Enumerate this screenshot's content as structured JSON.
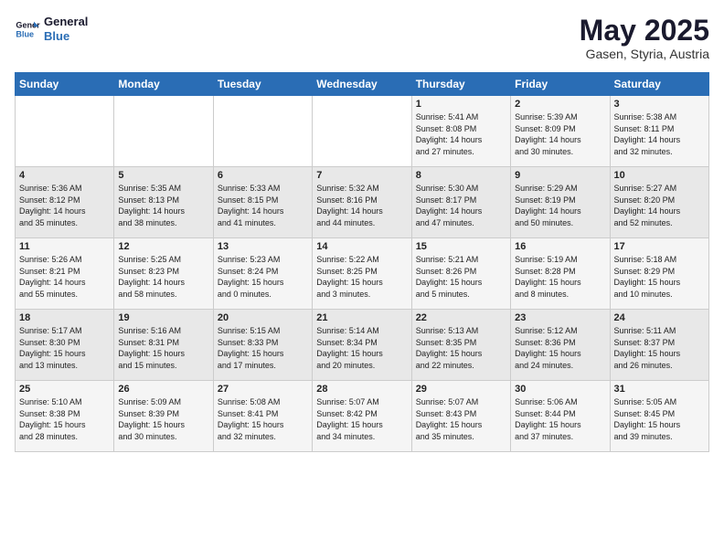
{
  "logo": {
    "line1": "General",
    "line2": "Blue"
  },
  "title": "May 2025",
  "location": "Gasen, Styria, Austria",
  "weekdays": [
    "Sunday",
    "Monday",
    "Tuesday",
    "Wednesday",
    "Thursday",
    "Friday",
    "Saturday"
  ],
  "weeks": [
    [
      {
        "day": "",
        "info": ""
      },
      {
        "day": "",
        "info": ""
      },
      {
        "day": "",
        "info": ""
      },
      {
        "day": "",
        "info": ""
      },
      {
        "day": "1",
        "info": "Sunrise: 5:41 AM\nSunset: 8:08 PM\nDaylight: 14 hours\nand 27 minutes."
      },
      {
        "day": "2",
        "info": "Sunrise: 5:39 AM\nSunset: 8:09 PM\nDaylight: 14 hours\nand 30 minutes."
      },
      {
        "day": "3",
        "info": "Sunrise: 5:38 AM\nSunset: 8:11 PM\nDaylight: 14 hours\nand 32 minutes."
      }
    ],
    [
      {
        "day": "4",
        "info": "Sunrise: 5:36 AM\nSunset: 8:12 PM\nDaylight: 14 hours\nand 35 minutes."
      },
      {
        "day": "5",
        "info": "Sunrise: 5:35 AM\nSunset: 8:13 PM\nDaylight: 14 hours\nand 38 minutes."
      },
      {
        "day": "6",
        "info": "Sunrise: 5:33 AM\nSunset: 8:15 PM\nDaylight: 14 hours\nand 41 minutes."
      },
      {
        "day": "7",
        "info": "Sunrise: 5:32 AM\nSunset: 8:16 PM\nDaylight: 14 hours\nand 44 minutes."
      },
      {
        "day": "8",
        "info": "Sunrise: 5:30 AM\nSunset: 8:17 PM\nDaylight: 14 hours\nand 47 minutes."
      },
      {
        "day": "9",
        "info": "Sunrise: 5:29 AM\nSunset: 8:19 PM\nDaylight: 14 hours\nand 50 minutes."
      },
      {
        "day": "10",
        "info": "Sunrise: 5:27 AM\nSunset: 8:20 PM\nDaylight: 14 hours\nand 52 minutes."
      }
    ],
    [
      {
        "day": "11",
        "info": "Sunrise: 5:26 AM\nSunset: 8:21 PM\nDaylight: 14 hours\nand 55 minutes."
      },
      {
        "day": "12",
        "info": "Sunrise: 5:25 AM\nSunset: 8:23 PM\nDaylight: 14 hours\nand 58 minutes."
      },
      {
        "day": "13",
        "info": "Sunrise: 5:23 AM\nSunset: 8:24 PM\nDaylight: 15 hours\nand 0 minutes."
      },
      {
        "day": "14",
        "info": "Sunrise: 5:22 AM\nSunset: 8:25 PM\nDaylight: 15 hours\nand 3 minutes."
      },
      {
        "day": "15",
        "info": "Sunrise: 5:21 AM\nSunset: 8:26 PM\nDaylight: 15 hours\nand 5 minutes."
      },
      {
        "day": "16",
        "info": "Sunrise: 5:19 AM\nSunset: 8:28 PM\nDaylight: 15 hours\nand 8 minutes."
      },
      {
        "day": "17",
        "info": "Sunrise: 5:18 AM\nSunset: 8:29 PM\nDaylight: 15 hours\nand 10 minutes."
      }
    ],
    [
      {
        "day": "18",
        "info": "Sunrise: 5:17 AM\nSunset: 8:30 PM\nDaylight: 15 hours\nand 13 minutes."
      },
      {
        "day": "19",
        "info": "Sunrise: 5:16 AM\nSunset: 8:31 PM\nDaylight: 15 hours\nand 15 minutes."
      },
      {
        "day": "20",
        "info": "Sunrise: 5:15 AM\nSunset: 8:33 PM\nDaylight: 15 hours\nand 17 minutes."
      },
      {
        "day": "21",
        "info": "Sunrise: 5:14 AM\nSunset: 8:34 PM\nDaylight: 15 hours\nand 20 minutes."
      },
      {
        "day": "22",
        "info": "Sunrise: 5:13 AM\nSunset: 8:35 PM\nDaylight: 15 hours\nand 22 minutes."
      },
      {
        "day": "23",
        "info": "Sunrise: 5:12 AM\nSunset: 8:36 PM\nDaylight: 15 hours\nand 24 minutes."
      },
      {
        "day": "24",
        "info": "Sunrise: 5:11 AM\nSunset: 8:37 PM\nDaylight: 15 hours\nand 26 minutes."
      }
    ],
    [
      {
        "day": "25",
        "info": "Sunrise: 5:10 AM\nSunset: 8:38 PM\nDaylight: 15 hours\nand 28 minutes."
      },
      {
        "day": "26",
        "info": "Sunrise: 5:09 AM\nSunset: 8:39 PM\nDaylight: 15 hours\nand 30 minutes."
      },
      {
        "day": "27",
        "info": "Sunrise: 5:08 AM\nSunset: 8:41 PM\nDaylight: 15 hours\nand 32 minutes."
      },
      {
        "day": "28",
        "info": "Sunrise: 5:07 AM\nSunset: 8:42 PM\nDaylight: 15 hours\nand 34 minutes."
      },
      {
        "day": "29",
        "info": "Sunrise: 5:07 AM\nSunset: 8:43 PM\nDaylight: 15 hours\nand 35 minutes."
      },
      {
        "day": "30",
        "info": "Sunrise: 5:06 AM\nSunset: 8:44 PM\nDaylight: 15 hours\nand 37 minutes."
      },
      {
        "day": "31",
        "info": "Sunrise: 5:05 AM\nSunset: 8:45 PM\nDaylight: 15 hours\nand 39 minutes."
      }
    ]
  ]
}
